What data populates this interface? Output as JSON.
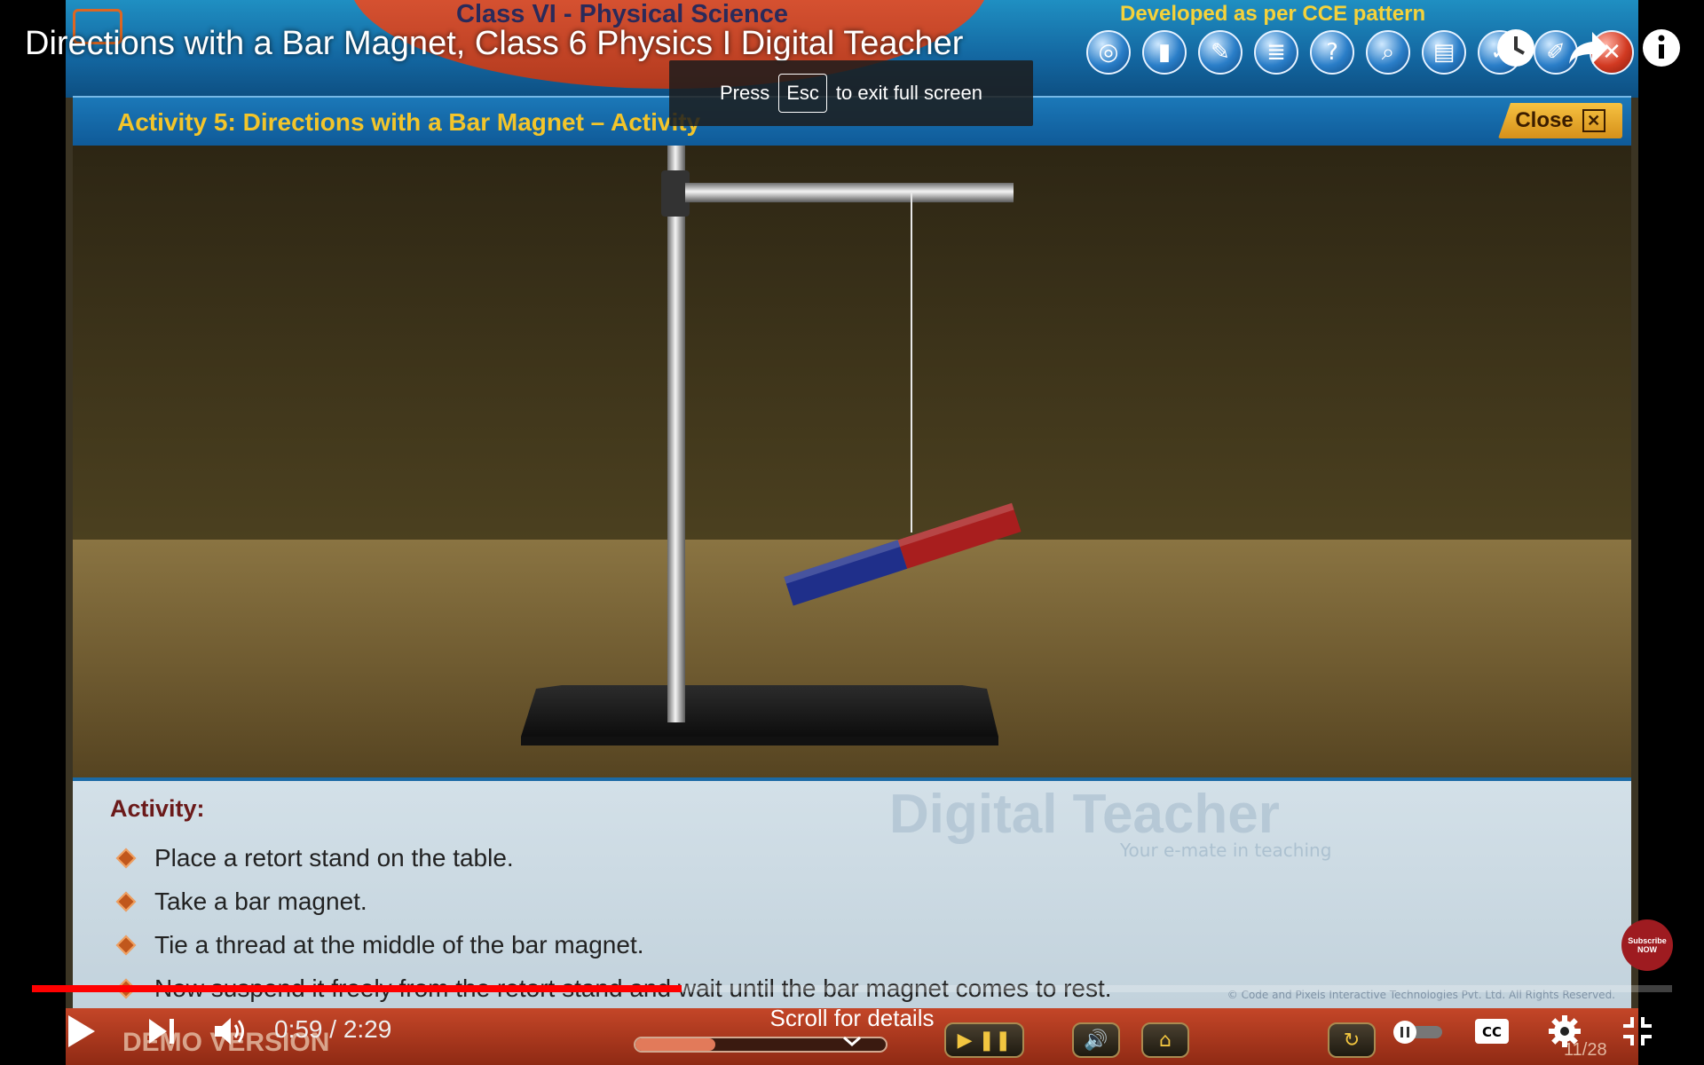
{
  "player": {
    "video_title": "Directions with a Bar Magnet, Class 6 Physics I Digital Teacher",
    "esc_prefix": "Press",
    "esc_key": "Esc",
    "esc_suffix": "to exit full screen",
    "time_display": "0:59 / 2:29",
    "progress_fraction": 0.396,
    "scroll_hint": "Scroll for details",
    "top_icons": [
      "watch-later-icon",
      "share-icon",
      "info-icon"
    ],
    "controls_icons": [
      "play-icon",
      "next-icon",
      "volume-icon",
      "autoplay-toggle-icon",
      "captions-icon",
      "settings-icon",
      "exit-fullscreen-icon"
    ],
    "accent": "#ff0000"
  },
  "video_frame": {
    "header_class": "Class VI - Physical Science",
    "header_cce": "Developed as per CCE pattern",
    "activity_title": "Activity 5: Directions with a Bar Magnet – Activity",
    "close_label": "Close",
    "toolbar_icons": [
      "globe-icon",
      "book-icon",
      "quiz-icon",
      "notes-icon",
      "help-icon",
      "search-icon",
      "dictionary-icon",
      "tick-icon",
      "edit-icon",
      "exit-icon"
    ],
    "activity_heading": "Activity:",
    "steps": [
      "Place a retort stand on the table.",
      "Take a bar magnet.",
      "Tie a thread at the middle of the bar magnet.",
      "Now suspend it freely from the retort stand and wait until the bar magnet comes to rest."
    ],
    "watermark": "Digital Teacher",
    "watermark_sub": "Your e-mate in teaching",
    "copyright": "© Code and Pixels Interactive Technologies Pvt. Ltd. All Rights Reserved.",
    "demo_label": "DEMO VERSION",
    "page_count": "11/28",
    "frame_seek_fraction": 0.32
  }
}
